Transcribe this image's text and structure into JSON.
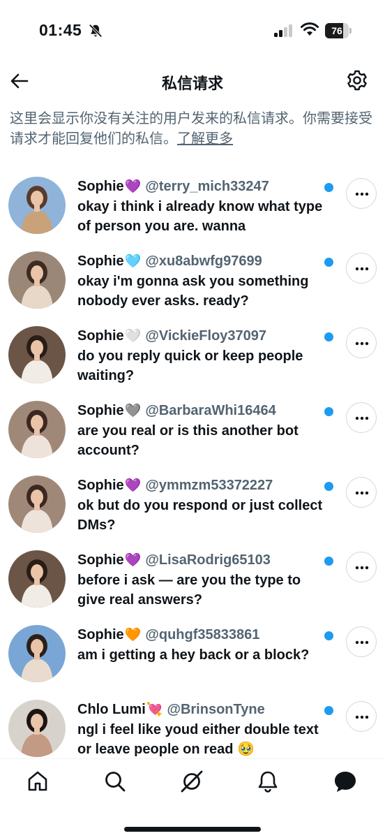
{
  "status_bar": {
    "time": "01:45",
    "battery": "76",
    "battery_level": 0.76
  },
  "header": {
    "title": "私信请求"
  },
  "intro": {
    "text": "这里会显示你没有关注的用户发来的私信请求。你需要接受请求才能回复他们的私信。",
    "learn_more": "了解更多"
  },
  "requests": [
    {
      "name": "Sophie",
      "emoji": "💜",
      "emoji_color": "#a855f7",
      "handle": "@terry_mich33247",
      "message": "okay i think i already know what type of person you are. wanna",
      "avatar_colors": [
        "#8fb3d9",
        "#c9a27a",
        "#5a3a2a"
      ]
    },
    {
      "name": "Sophie",
      "emoji": "🩵",
      "emoji_color": "#7dd3fc",
      "handle": "@xu8abwfg97699",
      "message": "okay i'm gonna ask you something nobody ever asks. ready?",
      "avatar_colors": [
        "#9b8777",
        "#e8d8c8",
        "#3d2b22"
      ]
    },
    {
      "name": "Sophie",
      "emoji": "🤍",
      "emoji_color": "#e5e7eb",
      "handle": "@VickieFloy37097",
      "message": "do you reply quick or keep people waiting?",
      "avatar_colors": [
        "#6b5547",
        "#f1ece6",
        "#2a1c17"
      ]
    },
    {
      "name": "Sophie",
      "emoji": "🩶",
      "emoji_color": "#6b7280",
      "handle": "@BarbaraWhi16464",
      "message": "are you real or is this another bot account?",
      "avatar_colors": [
        "#a08878",
        "#eee3da",
        "#3b2820"
      ]
    },
    {
      "name": "Sophie",
      "emoji": "💜",
      "emoji_color": "#a855f7",
      "handle": "@ymmzm53372227",
      "message": "ok but do you respond or just collect DMs?",
      "avatar_colors": [
        "#a08878",
        "#eee3da",
        "#3b2820"
      ]
    },
    {
      "name": "Sophie",
      "emoji": "💜",
      "emoji_color": "#a855f7",
      "handle": "@LisaRodrig65103",
      "message": "before i ask — are you the type to give real answers?",
      "avatar_colors": [
        "#6b5547",
        "#f1ece6",
        "#2a1c17"
      ]
    },
    {
      "name": "Sophie",
      "emoji": "🧡",
      "emoji_color": "#f97316",
      "handle": "@quhgf35833861",
      "message": "am i getting a hey back or a block?",
      "avatar_colors": [
        "#7aa6d6",
        "#e9dccf",
        "#2b1f1a"
      ]
    },
    {
      "name": "Chlo Lumi",
      "emoji": "💘",
      "emoji_color": "#ec4899",
      "handle": "@BrinsonTyne",
      "message": "ngl i feel like youd either double text or leave people on read 🥹",
      "avatar_colors": [
        "#d8d2cc",
        "#c39a84",
        "#1c1411"
      ]
    }
  ],
  "colors": {
    "accent": "#1d9bf0",
    "text": "#0f1419",
    "secondary": "#536471"
  },
  "tabs": [
    {
      "name": "home",
      "icon": "home-icon"
    },
    {
      "name": "search",
      "icon": "search-icon"
    },
    {
      "name": "grok",
      "icon": "grok-icon"
    },
    {
      "name": "notifications",
      "icon": "bell-icon"
    },
    {
      "name": "messages",
      "icon": "messages-icon"
    }
  ]
}
